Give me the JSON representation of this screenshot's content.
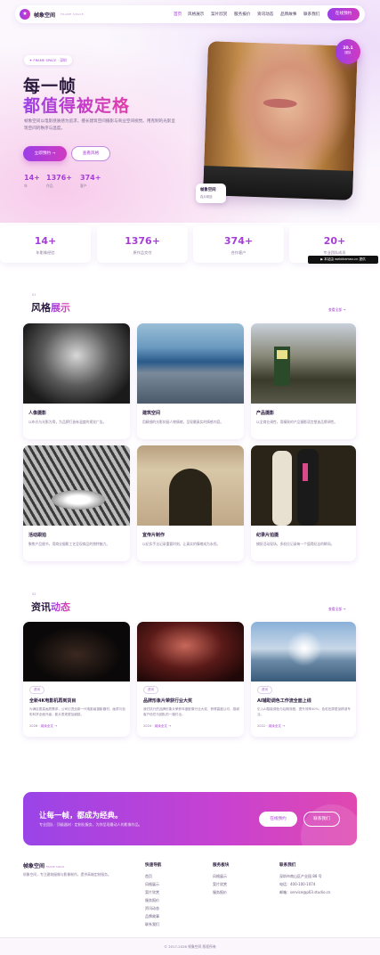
{
  "colors": {
    "accent": "#a53ed8",
    "pink": "#e23fa8",
    "dark": "#2a1a3e"
  },
  "header": {
    "logo": "帧象空间",
    "logo_sub": "FRAME SPACE",
    "nav": [
      "首页",
      "风格展示",
      "案片欣赏",
      "服务报价",
      "资讯动态",
      "品牌故事",
      "联系我们"
    ],
    "cta": "在线预约"
  },
  "hero": {
    "pill": "✦ FRAME SPACE · 深圳",
    "title1": "每一帧",
    "title2": "都值得被定格",
    "desc": "帧象空间以电影感质感为追求，擅长建筑空间摄影与商业空间视觉。用克制的光影呈现空间的秩序与温度。",
    "btn_primary": "立即预约 →",
    "btn_secondary": "查看风格",
    "stats": [
      {
        "num": "14+",
        "lbl": "年"
      },
      {
        "num": "1376+",
        "lbl": "作品"
      },
      {
        "num": "374+",
        "lbl": "客户"
      }
    ],
    "badge_top": "20.1",
    "badge_bot": "团队",
    "photo_label": "帧象空间",
    "photo_sub": "真片精选"
  },
  "stats": [
    {
      "num": "14+",
      "lbl": "年影像经验"
    },
    {
      "num": "1376+",
      "lbl": "原作品交付"
    },
    {
      "num": "374+",
      "lbl": "合作客户"
    },
    {
      "num": "20+",
      "lbl": "专业团队成员"
    }
  ],
  "watermark": "▶ 本站由 webthemez.cn 提供",
  "styles": {
    "idx": "01",
    "title_a": "风格",
    "title_b": "展示",
    "more": "查看全部 →",
    "items": [
      {
        "title": "人像摄影",
        "desc": "以布光与光影为骨，为品牌打造有温度的视觉广告。"
      },
      {
        "title": "建筑空间",
        "desc": "用精细的光影刻画人物情绪，呈现最真实的情感内容。"
      },
      {
        "title": "产品摄影",
        "desc": "以全商业调性，用精致的产品摄影语言塑造品牌调性。"
      },
      {
        "title": "活动跟拍",
        "desc": "聚焦产品细节，用商业摄影工艺呈现商品的独特魅力。"
      },
      {
        "title": "宣传片制作",
        "desc": "以纪实手法记录重要时刻，让真实的情绪成为永恒。"
      },
      {
        "title": "纪录片拍摄",
        "desc": "捕捉活动现场，多机位记录每一个值得纪念的瞬间。"
      }
    ]
  },
  "news": {
    "idx": "02",
    "title_a": "资讯",
    "title_b": "动态",
    "more": "查看全部 →",
    "read": "阅读全文 →",
    "items": [
      {
        "tag": "资讯",
        "title": "全新4K电影机再到货目",
        "desc": "为满足更高画质需求，公司引进全新一代电影级摄影器材，画质与色彩科学全面升级，影片表现更加细腻。",
        "date": "2026"
      },
      {
        "tag": "资讯",
        "title": "品牌形象片荣获行业大奖",
        "desc": "我们执行的品牌形象片荣获年度影像行业大奖，获得高度认可，感谢客户信任与团队的一路付出。",
        "date": "2024"
      },
      {
        "tag": "资讯",
        "title": "AI辅助调色工作流全面上线",
        "desc": "引入AI智能调色与后期流程，提升效率40%，色彩还原更加精准专业。",
        "date": "2022"
      }
    ]
  },
  "cta": {
    "title": "让每一帧，都成为经典。",
    "desc": "专业团队 · 顶级器材 · 定制化服务，为你呈现最动人的影像作品。",
    "btn1": "在线预约",
    "btn2": "联系我们"
  },
  "footer": {
    "logo": "帧象空间",
    "logo_sub": "FRAME SPACE",
    "about": "帧象空间，专注建筑摄像与影像制作，提供高端定制服务。",
    "col1": {
      "h": "快速导航",
      "links": [
        "首页",
        "风格展示",
        "案片欣赏",
        "服务报价",
        "资讯动态",
        "品牌故事",
        "联系我们"
      ]
    },
    "col2": {
      "h": "服务板块",
      "links": [
        "风格展示",
        "案片欣赏",
        "服务报价"
      ]
    },
    "col3": {
      "h": "联系我们",
      "links": [
        "深圳市南山区产业园 88 号",
        "电话：400-100-1074",
        "邮箱：service@p03.studio.cn"
      ]
    },
    "copyright": "© 2017-2026 帧象空间 版权所有"
  }
}
